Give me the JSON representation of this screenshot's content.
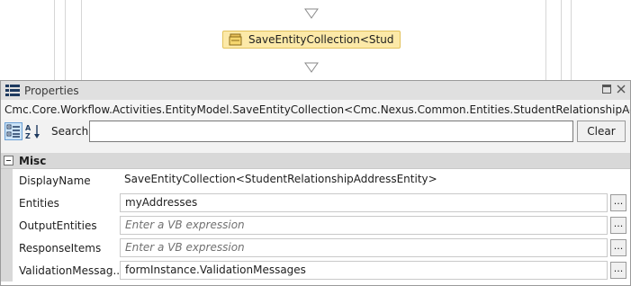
{
  "designer": {
    "activity_label": "SaveEntityCollection<Stud"
  },
  "properties": {
    "title": "Properties",
    "selected_type": "Cmc.Core.Workflow.Activities.EntityModel.SaveEntityCollection<Cmc.Nexus.Common.Entities.StudentRelationshipAddressEntity>",
    "search_label": "Search:",
    "search_value": "",
    "clear_label": "Clear",
    "category": "Misc",
    "rows": [
      {
        "name": "DisplayName",
        "value": "SaveEntityCollection<StudentRelationshipAddressEntity>"
      },
      {
        "name": "Entities",
        "value": "myAddresses"
      },
      {
        "name": "OutputEntities",
        "value": "Enter a VB expression"
      },
      {
        "name": "ResponseItems",
        "value": "Enter a VB expression"
      },
      {
        "name": "ValidationMessag...",
        "value": "formInstance.ValidationMessages"
      }
    ],
    "ellipsis_label": "..."
  },
  "icons": {
    "window": "properties-grid-icon",
    "activity": "collection-activity-icon",
    "categorized": "categorized-view-icon",
    "alphabetical": "sort-az-icon",
    "dock": "dock-window-icon",
    "close": "close-icon"
  },
  "colors": {
    "activity_fill": "#fce9a8",
    "activity_border": "#e3c25b",
    "titlebar": "#e0e0e0",
    "category": "#d8d8d8"
  }
}
